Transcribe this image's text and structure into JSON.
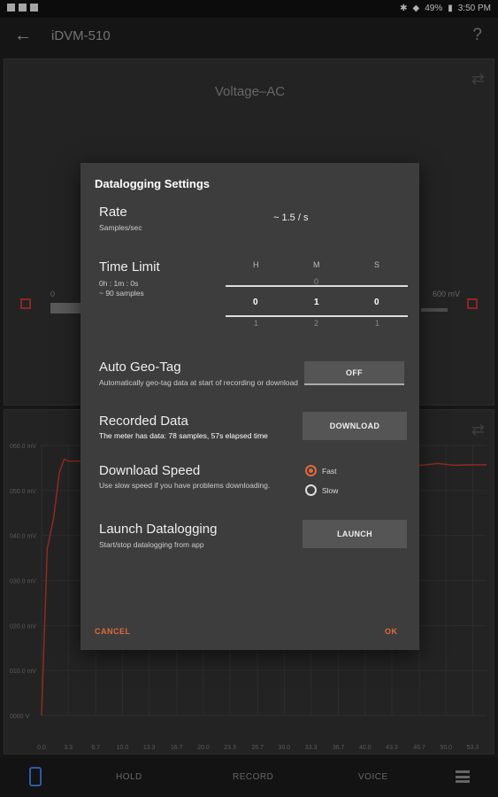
{
  "status_bar": {
    "battery": "49%",
    "time": "3:50 PM"
  },
  "app_bar": {
    "back_icon": "arrow-left-icon",
    "title": "iDVM-510",
    "help_icon": "?"
  },
  "meter": {
    "mode": "Voltage–AC",
    "reading": "",
    "range_min": "0",
    "range_max": "600 mV"
  },
  "chart_data": {
    "type": "line",
    "y_tick_labels": [
      "060.0 mV",
      "050.0 mV",
      "040.0 mV",
      "030.0 mV",
      "020.0 mV",
      "010.0 mV",
      "0000 V"
    ],
    "x_tick_labels": [
      "0.0",
      "3.3",
      "6.7",
      "10.0",
      "13.3",
      "16.7",
      "20.0",
      "23.3",
      "26.7",
      "30.0",
      "33.3",
      "36.7",
      "40.0",
      "43.3",
      "46.7",
      "50.0",
      "53.3"
    ],
    "ylim": [
      0,
      60
    ],
    "xlim": [
      0,
      55
    ],
    "series": [
      {
        "color": "#c0392b",
        "x": [
          0,
          0.7,
          1.5,
          2.2,
          2.8,
          3.3,
          5,
          8,
          12,
          16,
          20,
          24,
          28,
          31,
          34,
          38,
          42,
          45,
          47,
          49,
          51,
          53,
          55
        ],
        "values": [
          0,
          37,
          44,
          54,
          57,
          56.5,
          56.5,
          56,
          56,
          55.8,
          56,
          55.7,
          55.9,
          55.7,
          55.8,
          55.6,
          55.8,
          55.7,
          55.6,
          56,
          55.6,
          55.7,
          55.7
        ]
      }
    ]
  },
  "dialog": {
    "title": "Datalogging Settings",
    "rate": {
      "label": "Rate",
      "sub": "Samples/sec",
      "value": "~ 1.5 / s"
    },
    "time_limit": {
      "label": "Time Limit",
      "sub1": "0h : 1m : 0s",
      "sub2": "~ 90 samples",
      "cols": [
        "H",
        "M",
        "S"
      ],
      "above": [
        "",
        "0",
        ""
      ],
      "values": [
        "0",
        "1",
        "0"
      ],
      "below": [
        "1",
        "2",
        "1"
      ]
    },
    "geo_tag": {
      "label": "Auto Geo-Tag",
      "sub": "Automatically geo-tag data at start of recording or download",
      "button": "OFF"
    },
    "recorded": {
      "label": "Recorded Data",
      "sub": "The meter has data: 78 samples, 57s elapsed time",
      "button": "DOWNLOAD"
    },
    "speed": {
      "label": "Download Speed",
      "sub": "Use slow speed if you have problems downloading.",
      "fast": "Fast",
      "slow": "Slow",
      "selected": "Fast",
      "accent": "#e06a3a"
    },
    "launch": {
      "label": "Launch Datalogging",
      "sub": "Start/stop datalogging from app",
      "button": "LAUNCH"
    },
    "cancel": "CANCEL",
    "ok": "OK"
  },
  "bottom_bar": {
    "hold": "HOLD",
    "record": "RECORD",
    "voice": "VOICE"
  }
}
